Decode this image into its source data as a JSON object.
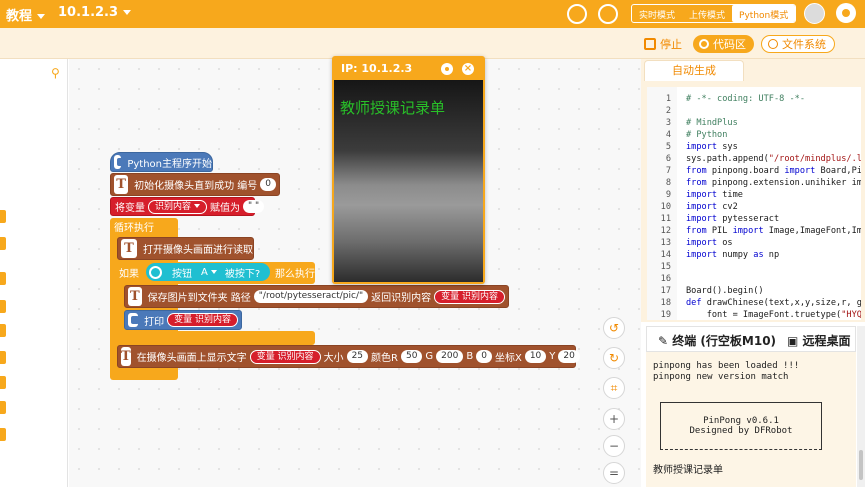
{
  "topbar": {
    "menu_label": "教程",
    "version_label": "10.1.2.3",
    "modes": [
      "实时模式",
      "上传模式",
      "Python模式"
    ],
    "active_mode": "Python模式"
  },
  "toolbar": {
    "stop_label": "停止",
    "code_label": "代码区",
    "files_label": "文件系统"
  },
  "blocks": {
    "main_start": "Python主程序开始",
    "init_camera": "初始化摄像头直到成功 编号",
    "init_camera_num": "0",
    "set_var": "将变量",
    "set_var_name": "识别内容",
    "set_var_assign": "赋值为",
    "set_var_value": "\" \"",
    "loop": "循环执行",
    "open_camera": "打开摄像头画面进行读取",
    "if_label": "如果",
    "button_label": "按钮",
    "button_key": "A",
    "pressed": "被按下?",
    "then": "那么执行",
    "save_img": "保存图片到文件夹 路径",
    "save_path": "\"/root/pytesseract/pic/\"",
    "return_recog": "返回识别内容",
    "var_recog": "变量 识别内容",
    "print_label": "打印",
    "print_var": "变量 识别内容",
    "show_text": "在摄像头画面上显示文字",
    "show_var": "变量 识别内容",
    "size_label": "大小",
    "size_val": "25",
    "color_r_label": "颜色R",
    "color_r": "50",
    "g_label": "G",
    "g_val": "200",
    "b_label": "B",
    "b_val": "0",
    "x_label": "坐标X",
    "x_val": "10",
    "y_label": "Y",
    "y_val": "20"
  },
  "camera_window": {
    "title": "IP: 10.1.2.3",
    "overlay_text": "教师授课记录单"
  },
  "code_panel": {
    "tab_label": "自动生成",
    "lines": [
      {
        "n": "1",
        "t": "# -*- coding: UTF-8 -*-"
      },
      {
        "n": "2",
        "t": ""
      },
      {
        "n": "3",
        "t": "# MindPlus"
      },
      {
        "n": "4",
        "t": "# Python"
      },
      {
        "n": "5",
        "t": "import sys"
      },
      {
        "n": "6",
        "t": "sys.path.append(\"/root/mindplus/.lib/"
      },
      {
        "n": "7",
        "t": "from pinpong.board import Board,Pin"
      },
      {
        "n": "8",
        "t": "from pinpong.extension.unihiker impor"
      },
      {
        "n": "9",
        "t": "import time"
      },
      {
        "n": "10",
        "t": "import cv2"
      },
      {
        "n": "11",
        "t": "import pytesseract"
      },
      {
        "n": "12",
        "t": "from PIL import Image,ImageFont,Image"
      },
      {
        "n": "13",
        "t": "import os"
      },
      {
        "n": "14",
        "t": "import numpy as np"
      },
      {
        "n": "15",
        "t": ""
      },
      {
        "n": "16",
        "t": ""
      },
      {
        "n": "17",
        "t": "Board().begin()"
      },
      {
        "n": "18",
        "t": "def drawChinese(text,x,y,size,r, g, b"
      },
      {
        "n": "19",
        "t": "    font = ImageFont.truetype(\"HYQiH"
      }
    ]
  },
  "terminal": {
    "title": "终端 (行空板M10)",
    "remote_label": "远程桌面",
    "lines": [
      "pinpong has been loaded !!!",
      "pinpong new version match"
    ],
    "box_line1": "PinPong v0.6.1",
    "box_line2": "Designed by DFRobot",
    "output": "教师授课记录单"
  }
}
